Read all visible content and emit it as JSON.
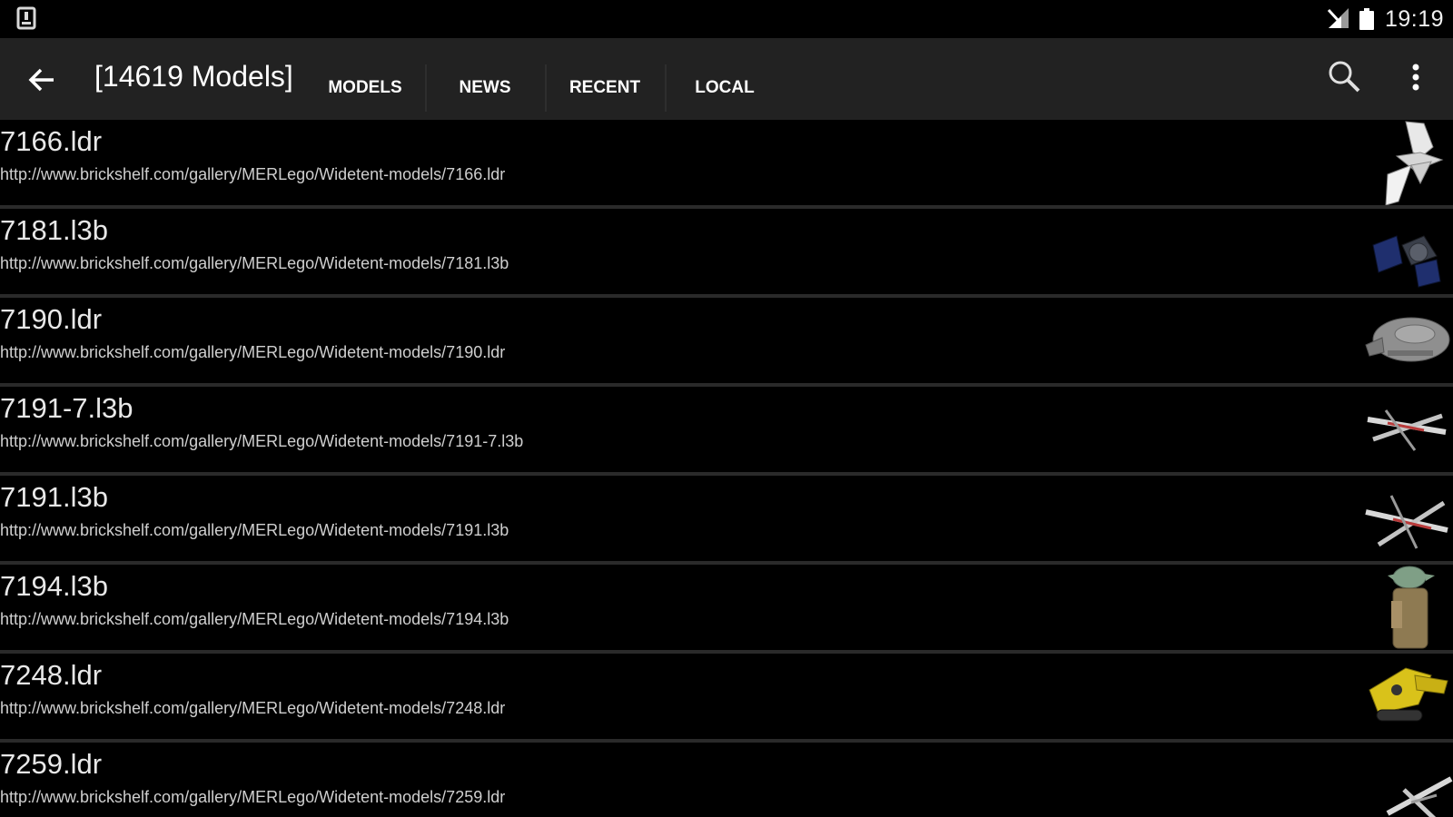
{
  "status_bar": {
    "time": "19:19",
    "left_icon": "download-notification-icon",
    "signal_icon": "cell-signal-icon",
    "battery_icon": "battery-icon"
  },
  "app_bar": {
    "back_icon": "arrow-back-icon",
    "title": "[14619 Models]",
    "tabs": [
      {
        "label": "MODELS"
      },
      {
        "label": "NEWS"
      },
      {
        "label": "RECENT"
      },
      {
        "label": "LOCAL"
      }
    ],
    "search_icon": "search-icon",
    "overflow_icon": "more-vert-icon",
    "background_color": "#222222"
  },
  "models": [
    {
      "name": "7166.ldr",
      "url": "http://www.brickshelf.com/gallery/MERLego/Widetent-models/7166.ldr",
      "thumbnail": "white-shuttle-model"
    },
    {
      "name": "7181.l3b",
      "url": "http://www.brickshelf.com/gallery/MERLego/Widetent-models/7181.l3b",
      "thumbnail": "tie-interceptor-model"
    },
    {
      "name": "7190.ldr",
      "url": "http://www.brickshelf.com/gallery/MERLego/Widetent-models/7190.ldr",
      "thumbnail": "millennium-falcon-model"
    },
    {
      "name": "7191-7.l3b",
      "url": "http://www.brickshelf.com/gallery/MERLego/Widetent-models/7191-7.l3b",
      "thumbnail": "x-wing-model"
    },
    {
      "name": "7191.l3b",
      "url": "http://www.brickshelf.com/gallery/MERLego/Widetent-models/7191.l3b",
      "thumbnail": "x-wing-model"
    },
    {
      "name": "7194.l3b",
      "url": "http://www.brickshelf.com/gallery/MERLego/Widetent-models/7194.l3b",
      "thumbnail": "yoda-model"
    },
    {
      "name": "7248.ldr",
      "url": "http://www.brickshelf.com/gallery/MERLego/Widetent-models/7248.ldr",
      "thumbnail": "yellow-digger-model"
    },
    {
      "name": "7259.ldr",
      "url": "http://www.brickshelf.com/gallery/MERLego/Widetent-models/7259.ldr",
      "thumbnail": "white-starfighter-model"
    }
  ]
}
